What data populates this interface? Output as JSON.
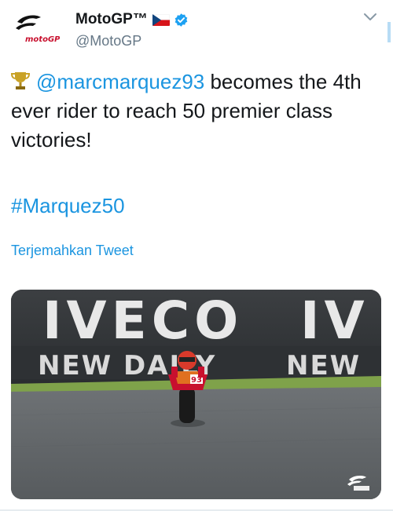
{
  "account": {
    "display_name": "MotoGP™",
    "handle": "@MotoGP",
    "flag_icon": "czech-flag-icon",
    "verified_icon": "verified-badge-icon",
    "avatar_logo_text": "motoGP"
  },
  "tweet": {
    "mention": "@marcmarquez93",
    "text_after_mention": " becomes the 4th ever rider to reach 50 premier class victories!",
    "hashtag": "#Marquez50",
    "translate_label": "Terjemahkan Tweet"
  },
  "media": {
    "banner_top_left": "IVECO",
    "banner_top_right": "IV",
    "banner_bottom_left": "NEW DAILY",
    "banner_bottom_right": "NEW",
    "bike_number": "93",
    "watermark_icon": "motogp-watermark-icon"
  },
  "colors": {
    "link": "#1b95e0",
    "text": "#14171a",
    "secondary": "#657786",
    "verified": "#1da1f2",
    "brand_red": "#c8102e"
  }
}
